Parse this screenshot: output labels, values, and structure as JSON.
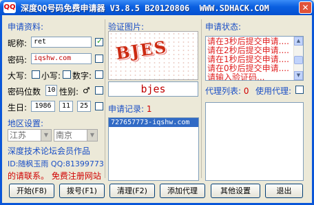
{
  "window": {
    "icon_text": "QQ",
    "title": "深度QQ号码免费申请器 V3.8.5 B20120806  WWW.SDHACK.COM",
    "close": "✕"
  },
  "apply_info": {
    "heading": "申请资料:",
    "nickname_label": "昵称:",
    "nickname_value": "ret",
    "nickname_checked": true,
    "password_label": "密码:",
    "password_value": "iqshw.com",
    "upper_label": "大写:",
    "lower_label": "小写:",
    "digit_label": "数字:",
    "pw_length_label": "密码位数",
    "pw_length_value": "10",
    "gender_label": "性别:",
    "gender_value": "♂",
    "birthday_label": "生日:",
    "birth_year": "1986",
    "birth_month": "11",
    "birth_day": "25"
  },
  "captcha": {
    "heading": "验证图片:",
    "image_text": "BJES",
    "input_value": "bjes"
  },
  "records": {
    "heading": "申请记录:",
    "count": "1",
    "items": [
      "727657773-iqshw.com"
    ]
  },
  "status": {
    "heading": "申请状态:",
    "lines": [
      "请在3秒后提交申请....",
      "请在2秒后提交申请....",
      "请在1秒后提交申请....",
      "请在0秒后提交申请....",
      "请输入验证码..."
    ]
  },
  "proxy": {
    "list_label": "代理列表:",
    "count": "0",
    "use_label": "使用代理:"
  },
  "region": {
    "heading": "地区设置:",
    "province": "江苏",
    "city": "南京"
  },
  "footer": {
    "credit": "深度技术论坛会员作品",
    "author": "ID:随枫玉雨 QQ:81399773",
    "notice": "的请联系。 免费注册网站"
  },
  "buttons": {
    "start": "开始(F8)",
    "dial": "拨号(F1)",
    "clear": "清理(F2)",
    "add_proxy": "添加代理",
    "other_settings": "其他设置",
    "exit": "退出"
  }
}
